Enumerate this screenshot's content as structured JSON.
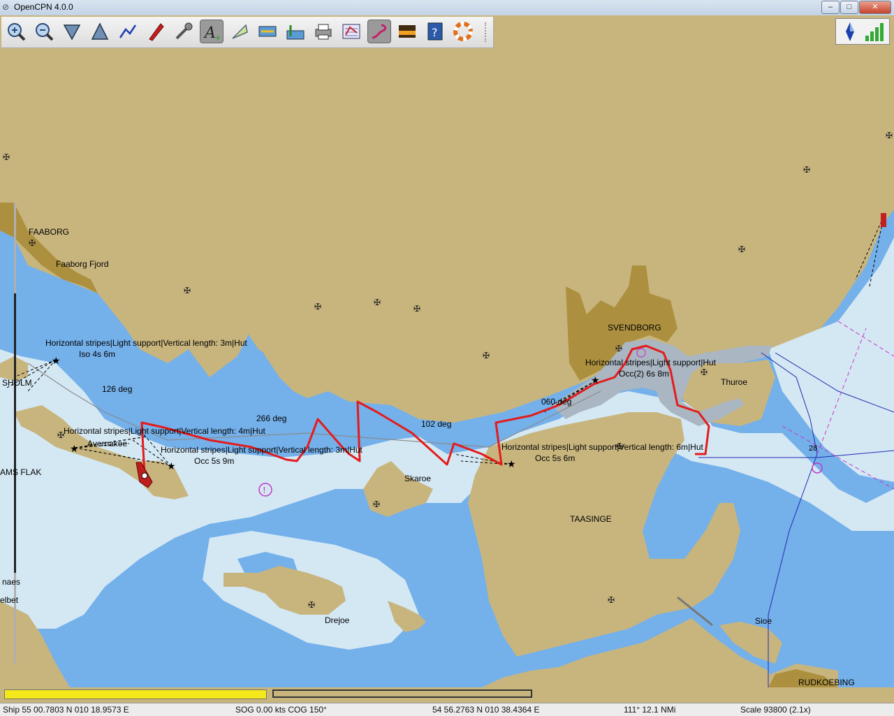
{
  "window": {
    "title": "OpenCPN 4.0.0",
    "min_symbol": "–",
    "max_symbol": "□",
    "close_symbol": "✕"
  },
  "toolbar": {
    "tools": [
      {
        "name": "zoom-in-icon",
        "active": false
      },
      {
        "name": "zoom-out-icon",
        "active": false
      },
      {
        "name": "scale-in-icon",
        "active": false
      },
      {
        "name": "scale-out-icon",
        "active": false
      },
      {
        "name": "route-icon",
        "active": false
      },
      {
        "name": "auto-follow-icon",
        "active": false
      },
      {
        "name": "settings-icon",
        "active": false
      },
      {
        "name": "text-icon",
        "active": true
      },
      {
        "name": "show-ais-icon",
        "active": false
      },
      {
        "name": "current-icon",
        "active": false
      },
      {
        "name": "tide-icon",
        "active": false
      },
      {
        "name": "print-icon",
        "active": false
      },
      {
        "name": "route-manager-icon",
        "active": false
      },
      {
        "name": "track-icon",
        "active": true
      },
      {
        "name": "color-scheme-icon",
        "active": false
      },
      {
        "name": "help-icon",
        "active": false
      },
      {
        "name": "mob-icon",
        "active": false
      }
    ]
  },
  "map_labels": {
    "faaborg": "FAABORG",
    "faaborg_fjord": "Faaborg Fjord",
    "svendborg": "SVENDBORG",
    "thuroe": "Thuroe",
    "taasinge": "TAASINGE",
    "skaroe": "Skaroe",
    "drejoe": "Drejoe",
    "sioe": "Sioe",
    "rudkoebing": "RUDKOEBING",
    "sholm": "SHOLM",
    "ams_flak": "AMS FLAK",
    "naes": "naes",
    "elbet": "elbet",
    "avernakoe": "Avernakoe",
    "light1_desc": "Horizontal stripes|Light support|Vertical length: 3m|Hut",
    "light1_char": "Iso 4s 6m",
    "light2_desc": "Horizontal stripes|Light support|Vertical length: 4m|Hut",
    "light3_desc": "Horizontal stripes|Light support|Vertical length: 3m|Hut",
    "light3_char": "Occ 5s 9m",
    "light4_desc": "Horizontal stripes|Light support|Hut",
    "light4_char": "Occ(2) 6s 8m",
    "light5_desc": "Horizontal stripes|Light support|Vertical length: 6m|Hut",
    "light5_char": "Occ 5s 6m",
    "deg_126": "126 deg",
    "deg_266": "266 deg",
    "deg_102": "102 deg",
    "deg_060": "060 deg",
    "depth_28": "28"
  },
  "status": {
    "ship": "Ship 55 00.7803 N   010 18.9573 E",
    "sog_cog": "SOG 0.00 kts  COG 150°",
    "cursor": "54 56.2763 N   010 38.4364 E",
    "bearing_dist": "111°  12.1 NMi",
    "scale": "Scale 93800 (2.1x)"
  },
  "colors": {
    "land": "#c8b57e",
    "urban": "#ac903f",
    "deep": "#74b0ea",
    "shallow": "#d4e8f4",
    "track": "#e31b1b"
  }
}
